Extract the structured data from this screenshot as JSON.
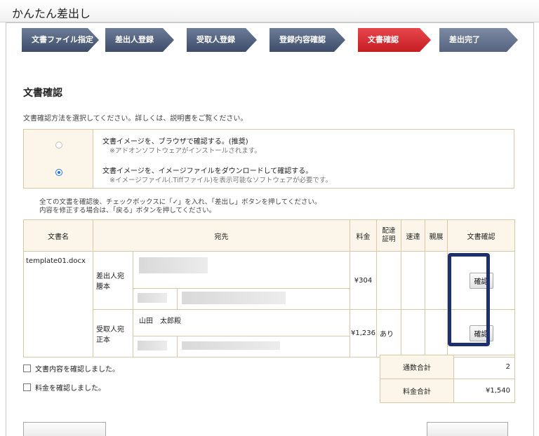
{
  "app": {
    "title": "かんたん差出し"
  },
  "steps": [
    {
      "label": "文書ファイル指定"
    },
    {
      "label": "差出人登録"
    },
    {
      "label": "受取人登録"
    },
    {
      "label": "登録内容確認"
    },
    {
      "label": "文書確認"
    },
    {
      "label": "差出完了"
    }
  ],
  "section": {
    "title": "文書確認",
    "description": "文書確認方法を選択してください。詳しくは、説明書をご覧ください。"
  },
  "options": [
    {
      "label": "文書イメージを、ブラウザで確認する。(推奨)",
      "sub": "※アドオンソフトウェアがインストールされます。",
      "selected": false
    },
    {
      "label": "文書イメージを、イメージファイルをダウンロードして確認する。",
      "sub": "※イメージファイル(.Tiffファイル)を表示可能なソフトウェアが必要です。",
      "selected": true
    }
  ],
  "notes": [
    "全ての文書を確認後、チェックボックスに「✓」を入れ、「差出し」ボタンを押してください。",
    "内容を修正する場合は、「戻る」ボタンを押してください。"
  ],
  "table": {
    "headers": {
      "doc_name": "文書名",
      "recipient": "宛先",
      "fee": "料金",
      "delivery_cert": "配達証明",
      "express": "速達",
      "personal": "親展",
      "doc_check": "文書確認"
    },
    "doc_file": "template01.docx",
    "rows": [
      {
        "type": "差出人宛謄本",
        "name": "",
        "fee": "¥304",
        "delivery_cert": "",
        "button": "確認"
      },
      {
        "type": "受取人宛正本",
        "name": "山田　太郎殿",
        "fee": "¥1,236",
        "delivery_cert": "あり",
        "button": "確認"
      }
    ]
  },
  "checks": [
    {
      "label": "文書内容を確認しました。"
    },
    {
      "label": "料金を確認しました。"
    }
  ],
  "summary": {
    "count_label": "通数合計",
    "count_value": "2",
    "fee_label": "料金合計",
    "fee_value": "¥1,540"
  },
  "colors": {
    "step": "#3d4c68",
    "active_step": "#c41d22",
    "highlight": "#1e2f6e"
  }
}
